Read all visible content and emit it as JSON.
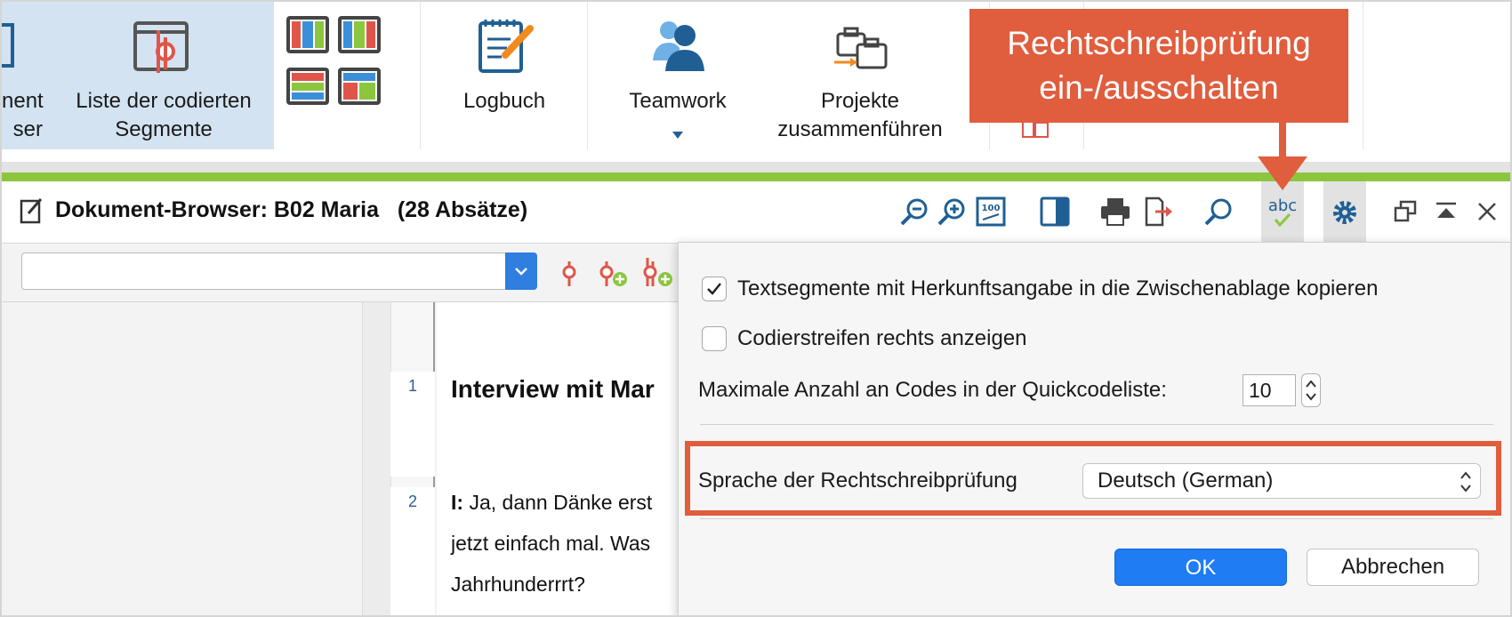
{
  "ribbon": {
    "items": [
      {
        "label_l1": "nent",
        "label_l2": "ser"
      },
      {
        "label_l1": "Liste der codierten",
        "label_l2": "Segmente"
      },
      {
        "label_l1": "Logbuch",
        "label_l2": ""
      },
      {
        "label_l1": "Teamwork",
        "label_l2": ""
      },
      {
        "label_l1": "Projekte",
        "label_l2": "zusammenführen"
      }
    ]
  },
  "window": {
    "title": "Dokument-Browser: B02 Maria   (28 Absätze)"
  },
  "document": {
    "paragraphs": [
      {
        "number": "1",
        "lines": [
          "Interview mit Mar"
        ]
      },
      {
        "number": "2",
        "speaker": "I:",
        "lines": [
          " Ja, dann Dänke erst",
          "jetzt einfach mal. Was",
          "Jahrhunderrrt?"
        ]
      }
    ]
  },
  "settings": {
    "copy_segments_label": "Textsegmente mit Herkunftsangabe in die Zwischenablage kopieren",
    "copy_segments_checked": true,
    "code_stripes_label": "Codierstreifen rechts anzeigen",
    "code_stripes_checked": false,
    "max_codes_label": "Maximale Anzahl an Codes in der Quickcodeliste:",
    "max_codes_value": "10",
    "spell_lang_label": "Sprache der Rechtschreibprüfung",
    "spell_lang_value": "Deutsch (German)",
    "ok_label": "OK",
    "cancel_label": "Abbrechen"
  },
  "annotation": {
    "callout_l1": "Rechtschreibprüfung",
    "callout_l2": "ein-/ausschalten",
    "color": "#e05d3d"
  },
  "colors": {
    "accent_green": "#8cc63f",
    "primary_blue": "#1f7cf2",
    "icon_blue": "#1f5f94",
    "code_red": "#e0554a"
  }
}
